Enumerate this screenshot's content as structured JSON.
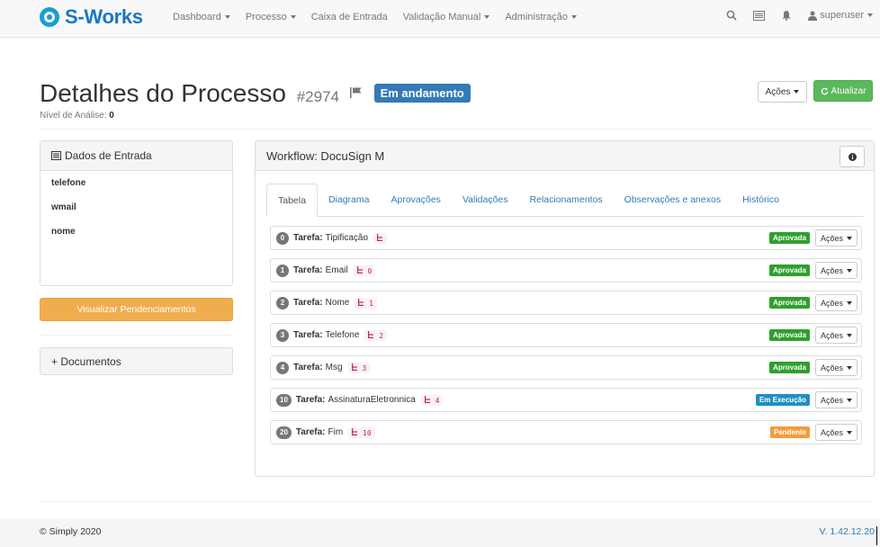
{
  "brand": {
    "name": "S-Works"
  },
  "nav": {
    "items": [
      {
        "label": "Dashboard",
        "dropdown": true
      },
      {
        "label": "Processo",
        "dropdown": true
      },
      {
        "label": "Caixa de Entrada",
        "dropdown": false
      },
      {
        "label": "Validação Manual",
        "dropdown": true
      },
      {
        "label": "Administração",
        "dropdown": true
      }
    ],
    "user": "superuser"
  },
  "header": {
    "title": "Detalhes do Processo",
    "process_id": "#2974",
    "status": "Em andamento",
    "analysis_level_label": "Nível de Análise:",
    "analysis_level_value": "0",
    "acoes_label": "Ações",
    "refresh_label": "Atualizar"
  },
  "entrada": {
    "title": "Dados de Entrada",
    "fields": [
      "telefone",
      "wmail",
      "nome"
    ],
    "pendencias_button": "Visualizar Pendenciamentos",
    "documentos": "+ Documentos"
  },
  "workflow": {
    "title": "Workflow: DocuSign M",
    "tabs": [
      "Tabela",
      "Diagrama",
      "Aprovações",
      "Validações",
      "Relacionamentos",
      "Observações e anexos",
      "Histórico"
    ],
    "active_tab": "Tabela",
    "task_prefix": "Tarefa:",
    "task_acoes": "Ações",
    "tasks": [
      {
        "num": "0",
        "name": "Tipificação",
        "code": "",
        "status": "Aprovada",
        "status_color": "#2ea02e"
      },
      {
        "num": "1",
        "name": "Email",
        "code": "0",
        "status": "Aprovada",
        "status_color": "#2ea02e"
      },
      {
        "num": "2",
        "name": "Nome",
        "code": "1",
        "status": "Aprovada",
        "status_color": "#2ea02e"
      },
      {
        "num": "3",
        "name": "Telefone",
        "code": "2",
        "status": "Aprovada",
        "status_color": "#2ea02e"
      },
      {
        "num": "4",
        "name": "Msg",
        "code": "3",
        "status": "Aprovada",
        "status_color": "#2ea02e"
      },
      {
        "num": "10",
        "name": "AssinaturaEletronnica",
        "code": "4",
        "status": "Em Execução",
        "status_color": "#1e8fc2"
      },
      {
        "num": "20",
        "name": "Fim",
        "code": "10",
        "status": "Pendente",
        "status_color": "#f39c3c"
      }
    ]
  },
  "footer": {
    "copyright": "© Simply 2020",
    "version": "V. 1.42.12.20"
  }
}
